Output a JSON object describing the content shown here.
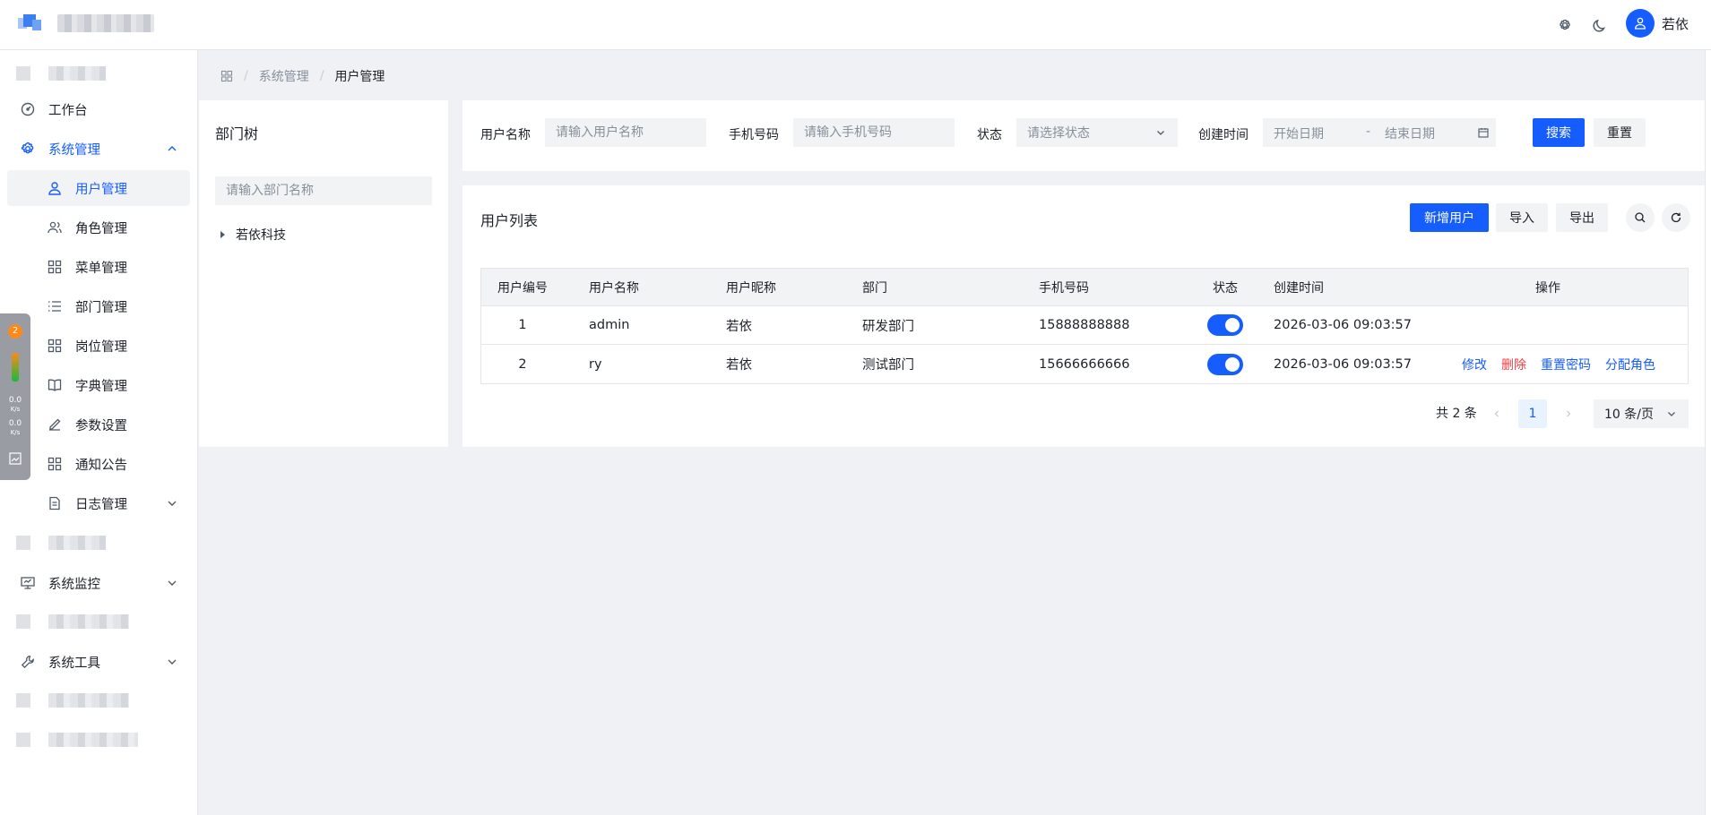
{
  "header": {
    "user_name": "若依",
    "icons": [
      "gear-icon",
      "moon-icon",
      "user-icon"
    ]
  },
  "sidebar": {
    "items": [
      {
        "label": "工作台",
        "icon": "dashboard-icon"
      },
      {
        "label": "系统管理",
        "icon": "gear-icon",
        "expanded": true
      },
      {
        "label": "用户管理",
        "icon": "user-icon",
        "active": true
      },
      {
        "label": "角色管理",
        "icon": "users-icon"
      },
      {
        "label": "菜单管理",
        "icon": "grid-icon"
      },
      {
        "label": "部门管理",
        "icon": "list-icon"
      },
      {
        "label": "岗位管理",
        "icon": "grid-icon"
      },
      {
        "label": "字典管理",
        "icon": "book-icon"
      },
      {
        "label": "参数设置",
        "icon": "edit-icon"
      },
      {
        "label": "通知公告",
        "icon": "grid-icon"
      },
      {
        "label": "日志管理",
        "icon": "file-icon"
      },
      {
        "label": "系统监控",
        "icon": "monitor-icon"
      },
      {
        "label": "系统工具",
        "icon": "tool-icon"
      }
    ]
  },
  "float_widget": {
    "badge": "2",
    "up_speed": "0.0",
    "up_unit": "K/s",
    "down_speed": "0.0",
    "down_unit": "K/s"
  },
  "breadcrumb": {
    "items": [
      "系统管理",
      "用户管理"
    ]
  },
  "dept": {
    "title": "部门树",
    "search_placeholder": "请输入部门名称",
    "tree": [
      "若依科技"
    ]
  },
  "search_form": {
    "username_label": "用户名称",
    "username_placeholder": "请输入用户名称",
    "phone_label": "手机号码",
    "phone_placeholder": "请输入手机号码",
    "status_label": "状态",
    "status_placeholder": "请选择状态",
    "created_label": "创建时间",
    "start_placeholder": "开始日期",
    "range_sep": "-",
    "end_placeholder": "结束日期",
    "search_btn": "搜索",
    "reset_btn": "重置"
  },
  "user_list": {
    "title": "用户列表",
    "add_btn": "新增用户",
    "import_btn": "导入",
    "export_btn": "导出",
    "columns": [
      "用户编号",
      "用户名称",
      "用户昵称",
      "部门",
      "手机号码",
      "状态",
      "创建时间",
      "操作"
    ],
    "rows": [
      {
        "id": "1",
        "username": "admin",
        "nickname": "若依",
        "dept": "研发部门",
        "phone": "15888888888",
        "status": true,
        "created": "2026-03-06 09:03:57",
        "actions": []
      },
      {
        "id": "2",
        "username": "ry",
        "nickname": "若依",
        "dept": "测试部门",
        "phone": "15666666666",
        "status": true,
        "created": "2026-03-06 09:03:57",
        "actions": [
          "修改",
          "删除",
          "重置密码",
          "分配角色"
        ]
      }
    ],
    "pagination": {
      "total_text": "共 2 条",
      "current_page": "1",
      "page_size": "10 条/页"
    }
  },
  "colors": {
    "primary": "#165dff",
    "danger": "#f53f3f",
    "background": "#f0f1f4"
  }
}
